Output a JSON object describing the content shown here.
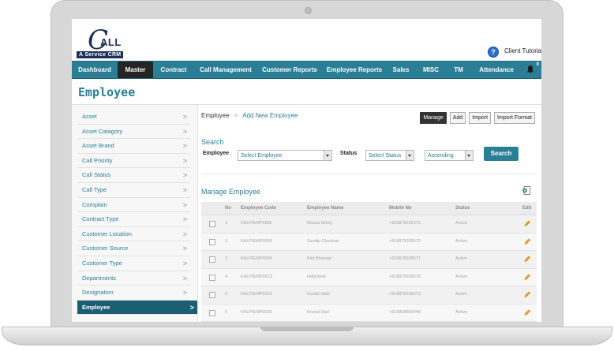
{
  "header": {
    "logo_letter": "C",
    "logo_text": "ALL",
    "logo_tagline": "A Service CRM",
    "help_icon_glyph": "?",
    "client_name": "Client Tutoria"
  },
  "nav": {
    "items": [
      {
        "label": "Dashboard",
        "active": false
      },
      {
        "label": "Master",
        "active": true
      },
      {
        "label": "Contract",
        "active": false
      },
      {
        "label": "Call Management",
        "active": false
      },
      {
        "label": "Customer Reports",
        "active": false
      },
      {
        "label": "Employee Reports",
        "active": false
      },
      {
        "label": "Sales",
        "active": false
      },
      {
        "label": "MISC",
        "active": false
      },
      {
        "label": "TM",
        "active": false
      },
      {
        "label": "Attendance",
        "active": false
      }
    ],
    "notification_count": "0"
  },
  "page": {
    "title": "Employee"
  },
  "sidebar": {
    "items": [
      {
        "label": "Asset"
      },
      {
        "label": "Asset Catagory"
      },
      {
        "label": "Asset Brand"
      },
      {
        "label": "Call Priority"
      },
      {
        "label": "Call Status"
      },
      {
        "label": "Call Type"
      },
      {
        "label": "Complain"
      },
      {
        "label": "Contract Type"
      },
      {
        "label": "Customer Location"
      },
      {
        "label": "Customer Source"
      },
      {
        "label": "Customer Type"
      },
      {
        "label": "Departments"
      },
      {
        "label": "Designation"
      },
      {
        "label": "Employee"
      }
    ],
    "active_index": 13
  },
  "breadcrumb": {
    "root": "Employee",
    "link": "Add New Employee"
  },
  "toolbar": {
    "manage": "Manage",
    "add": "Add",
    "import": "Import",
    "import_format": "Import Format"
  },
  "search": {
    "title": "Search",
    "employee_label": "Employee",
    "employee_value": "Select Employee",
    "status_label": "Status",
    "status_value": "Select Status",
    "order_value": "Ascending",
    "button": "Search"
  },
  "manage": {
    "title": "Manage Employee",
    "columns": [
      "No",
      "Employee Code",
      "Employee Name",
      "Mobile No",
      "Status",
      "Edit"
    ],
    "rows": [
      {
        "no": "1",
        "code": "KALPIEMP0002",
        "name": "Bharat Mistry",
        "mobile": "+918878205571",
        "status": "Active"
      },
      {
        "no": "2",
        "code": "KALPIEMP0003",
        "name": "Sandip Chauhan",
        "mobile": "+918878205572",
        "status": "Active"
      },
      {
        "no": "3",
        "code": "KALPIEMP0004",
        "name": "Kirit Bhavsar",
        "mobile": "+918878205577",
        "status": "Active"
      },
      {
        "no": "4",
        "code": "KALPIEMP0013",
        "name": "HelpDesk",
        "mobile": "+918878205576",
        "status": "Active"
      },
      {
        "no": "5",
        "code": "KALPIEMP0025",
        "name": "Kuntal Vakil",
        "mobile": "+918878205573",
        "status": "Active"
      },
      {
        "no": "6",
        "code": "KALPIEMP0035",
        "name": "Krunal Dazi",
        "mobile": "+918898809446",
        "status": "Active"
      }
    ]
  },
  "colors": {
    "primary": "#2a7f96",
    "dark": "#1c5f73",
    "active_nav": "#252525",
    "brand": "#1b2f5a"
  }
}
